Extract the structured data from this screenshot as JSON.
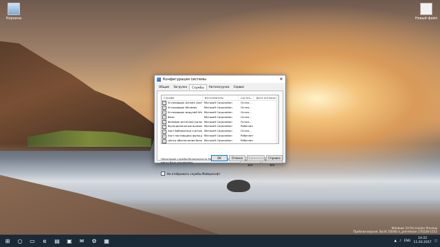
{
  "desktop": {
    "icons": [
      {
        "label": "Корзина",
        "icon": "recycle-bin-icon"
      },
      {
        "label": "Новый файл",
        "icon": "file-icon"
      }
    ]
  },
  "dialog": {
    "title": "Конфигурация системы",
    "tabs": [
      "Общие",
      "Загрузка",
      "Службы",
      "Автозагрузка",
      "Сервис"
    ],
    "active_tab": "Службы",
    "columns": [
      "Служба",
      "Изготовитель",
      "Состоя...",
      "Дата отключения"
    ],
    "rows": [
      {
        "name": "Установщик ActiveX (AxInstSV)",
        "maker": "Microsoft Corporation",
        "state": "Остан...",
        "date": "",
        "checked": true
      },
      {
        "name": "Установщик Windows",
        "maker": "Microsoft Corporation",
        "state": "Остан...",
        "date": "",
        "checked": true
      },
      {
        "name": "Установщик модулей Windows",
        "maker": "Microsoft Corporation",
        "state": "Остан...",
        "date": "",
        "checked": true
      },
      {
        "name": "Факс",
        "maker": "Microsoft Corporation",
        "state": "Остан...",
        "date": "",
        "checked": true
      },
      {
        "name": "Фоновая интеллектуальна...",
        "maker": "Microsoft Corporation",
        "state": "Остан...",
        "date": "",
        "checked": true
      },
      {
        "name": "Функциональные возможност...",
        "maker": "Microsoft Corporation",
        "state": "Работает",
        "date": "",
        "checked": true
      },
      {
        "name": "Хост библиотеки счетчика пр...",
        "maker": "Microsoft Corporation",
        "state": "Остан...",
        "date": "",
        "checked": true
      },
      {
        "name": "Хост поставщика функции об...",
        "maker": "Microsoft Corporation",
        "state": "Работает",
        "date": "",
        "checked": true
      },
      {
        "name": "Центр обеспечения безопасно...",
        "maker": "Microsoft Corporation",
        "state": "Работает",
        "date": "",
        "checked": true
      },
      {
        "name": "Центр обновления Windows",
        "maker": "Microsoft Corporation",
        "state": "Остан...",
        "date": "11.03.2017 00:...",
        "checked": true
      },
      {
        "name": "Шифрованная файловая систе...",
        "maker": "Microsoft Corporation",
        "state": "Остан...",
        "date": "",
        "checked": true
      }
    ],
    "selected_row": 9,
    "note": "Некоторые службы безопасности Майкрософт не могут быть отключены.",
    "enable_all": "Включить все",
    "disable_all": "Отключить все",
    "hide_ms": "Не отображать службы Майкрософт",
    "ok": "OK",
    "cancel": "Отмена",
    "apply": "Применить",
    "help": "Справка"
  },
  "taskbar": {
    "lang": "ENG",
    "time": "14:22",
    "date": "11.03.2017"
  },
  "watermark": {
    "line1": "Windows 10 Pro Insider Preview",
    "line2": "Пробная версия. Build 15048.rs_prerelease.170228-1522"
  }
}
